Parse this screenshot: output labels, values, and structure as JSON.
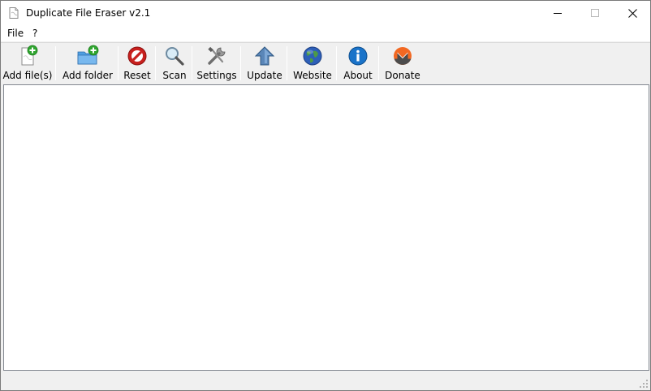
{
  "window": {
    "title": "Duplicate File Eraser v2.1"
  },
  "menu": {
    "file": "File",
    "help": "?"
  },
  "toolbar": {
    "add_files": "Add file(s)",
    "add_folder": "Add folder",
    "reset": "Reset",
    "scan": "Scan",
    "settings": "Settings",
    "update": "Update",
    "website": "Website",
    "about": "About",
    "donate": "Donate"
  },
  "icons": {
    "app": "document-icon",
    "add_files": "add-file-icon",
    "add_folder": "add-folder-icon",
    "reset": "no-entry-icon",
    "scan": "magnifier-icon",
    "settings": "wrench-icon",
    "update": "up-arrow-icon",
    "website": "globe-icon",
    "about": "info-icon",
    "donate": "monero-icon"
  },
  "colors": {
    "accent_green": "#2fa52f",
    "reset_red": "#c8201e",
    "info_blue": "#1a73c9",
    "monero_orange": "#f26822"
  }
}
